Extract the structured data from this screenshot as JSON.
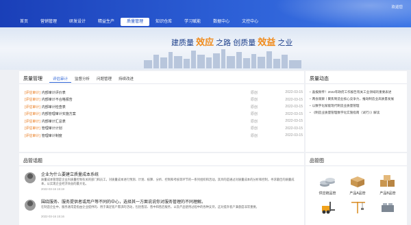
{
  "header": {
    "welcome": "欢迎您",
    "nav": [
      {
        "label": "首页",
        "active": false
      },
      {
        "label": "营销管理",
        "active": false
      },
      {
        "label": "研发设计",
        "active": false
      },
      {
        "label": "精益生产",
        "active": false
      },
      {
        "label": "质量管理",
        "active": true
      },
      {
        "label": "知识仓库",
        "active": false
      },
      {
        "label": "学习赋能",
        "active": false
      },
      {
        "label": "数据中心",
        "active": false
      },
      {
        "label": "文控中心",
        "active": false
      }
    ]
  },
  "banner": {
    "part1": "建质量",
    "hl1": "效应",
    "part2": "之路",
    "part3": "创质量",
    "hl2": "效益",
    "part4": "之业"
  },
  "quality": {
    "title": "质量管理",
    "tabs": [
      "评估审计",
      "监督分析",
      "问题管理",
      "持续改进"
    ],
    "active_tab": 0,
    "rows": [
      {
        "tag": "[评估审计]",
        "title": "内部审计评价表",
        "source": "原创",
        "date": "2022-03-15"
      },
      {
        "tag": "[评估审计]",
        "title": "内部审计不合格报告",
        "source": "原创",
        "date": "2022-03-15"
      },
      {
        "tag": "[评估审计]",
        "title": "内部审计检查表",
        "source": "原创",
        "date": "2022-03-15"
      },
      {
        "tag": "[评估审计]",
        "title": "内部管理审计实施方案",
        "source": "原创",
        "date": "2022-03-15"
      },
      {
        "tag": "[评估审计]",
        "title": "内部审计汇总表",
        "source": "原创",
        "date": "2022-03-15"
      },
      {
        "tag": "[评估审计]",
        "title": "管理审计计划",
        "source": "原创",
        "date": "2022-03-15"
      },
      {
        "tag": "[评估审计]",
        "title": "管理审计制度",
        "source": "原创",
        "date": "2022-03-15"
      }
    ]
  },
  "news": {
    "title": "质量动态",
    "items": [
      "喜报频传！2022年政府工作报告有关工业领域的重要表述",
      "两会观察丨聚焦制造业核心竞争力，推动制造业高质量发展",
      "以数字化赋能现代制造业质量管理",
      "《制造业质量管理数字化实施指南（试行）》解读"
    ]
  },
  "topics": {
    "title": "品管话题",
    "items": [
      {
        "title": "企业为什么要建立质量成本系统",
        "body": "质量成本管理是企业内质量控制有关的部门和员工，对质量成本进行预测、计划、核算、分析、控制和考核等环节的一系列组织和活动。其目的是通过对质量成本的分析和控制，寻求最佳的质量成本，以实现企业经济效益的最大化。",
        "date": "2022-03-16 15:19"
      },
      {
        "title": "围绕服务、服务提供者或用户等不同的中心，选择其一方面说说你对服务管理的不同理解。",
        "body": "在制造企业中，服务通常是指由企业提供的、用于满足客户需求的活动，包括售前、售中和售后服务，以及产品使用过程中的各种支持，这对提升客户满意度非常重要。",
        "date": "2022-03-16 15:16"
      }
    ]
  },
  "products": {
    "title": "品管图",
    "items": [
      "供应链品管",
      "产品A品管",
      "产品B品管",
      "",
      "",
      ""
    ]
  }
}
